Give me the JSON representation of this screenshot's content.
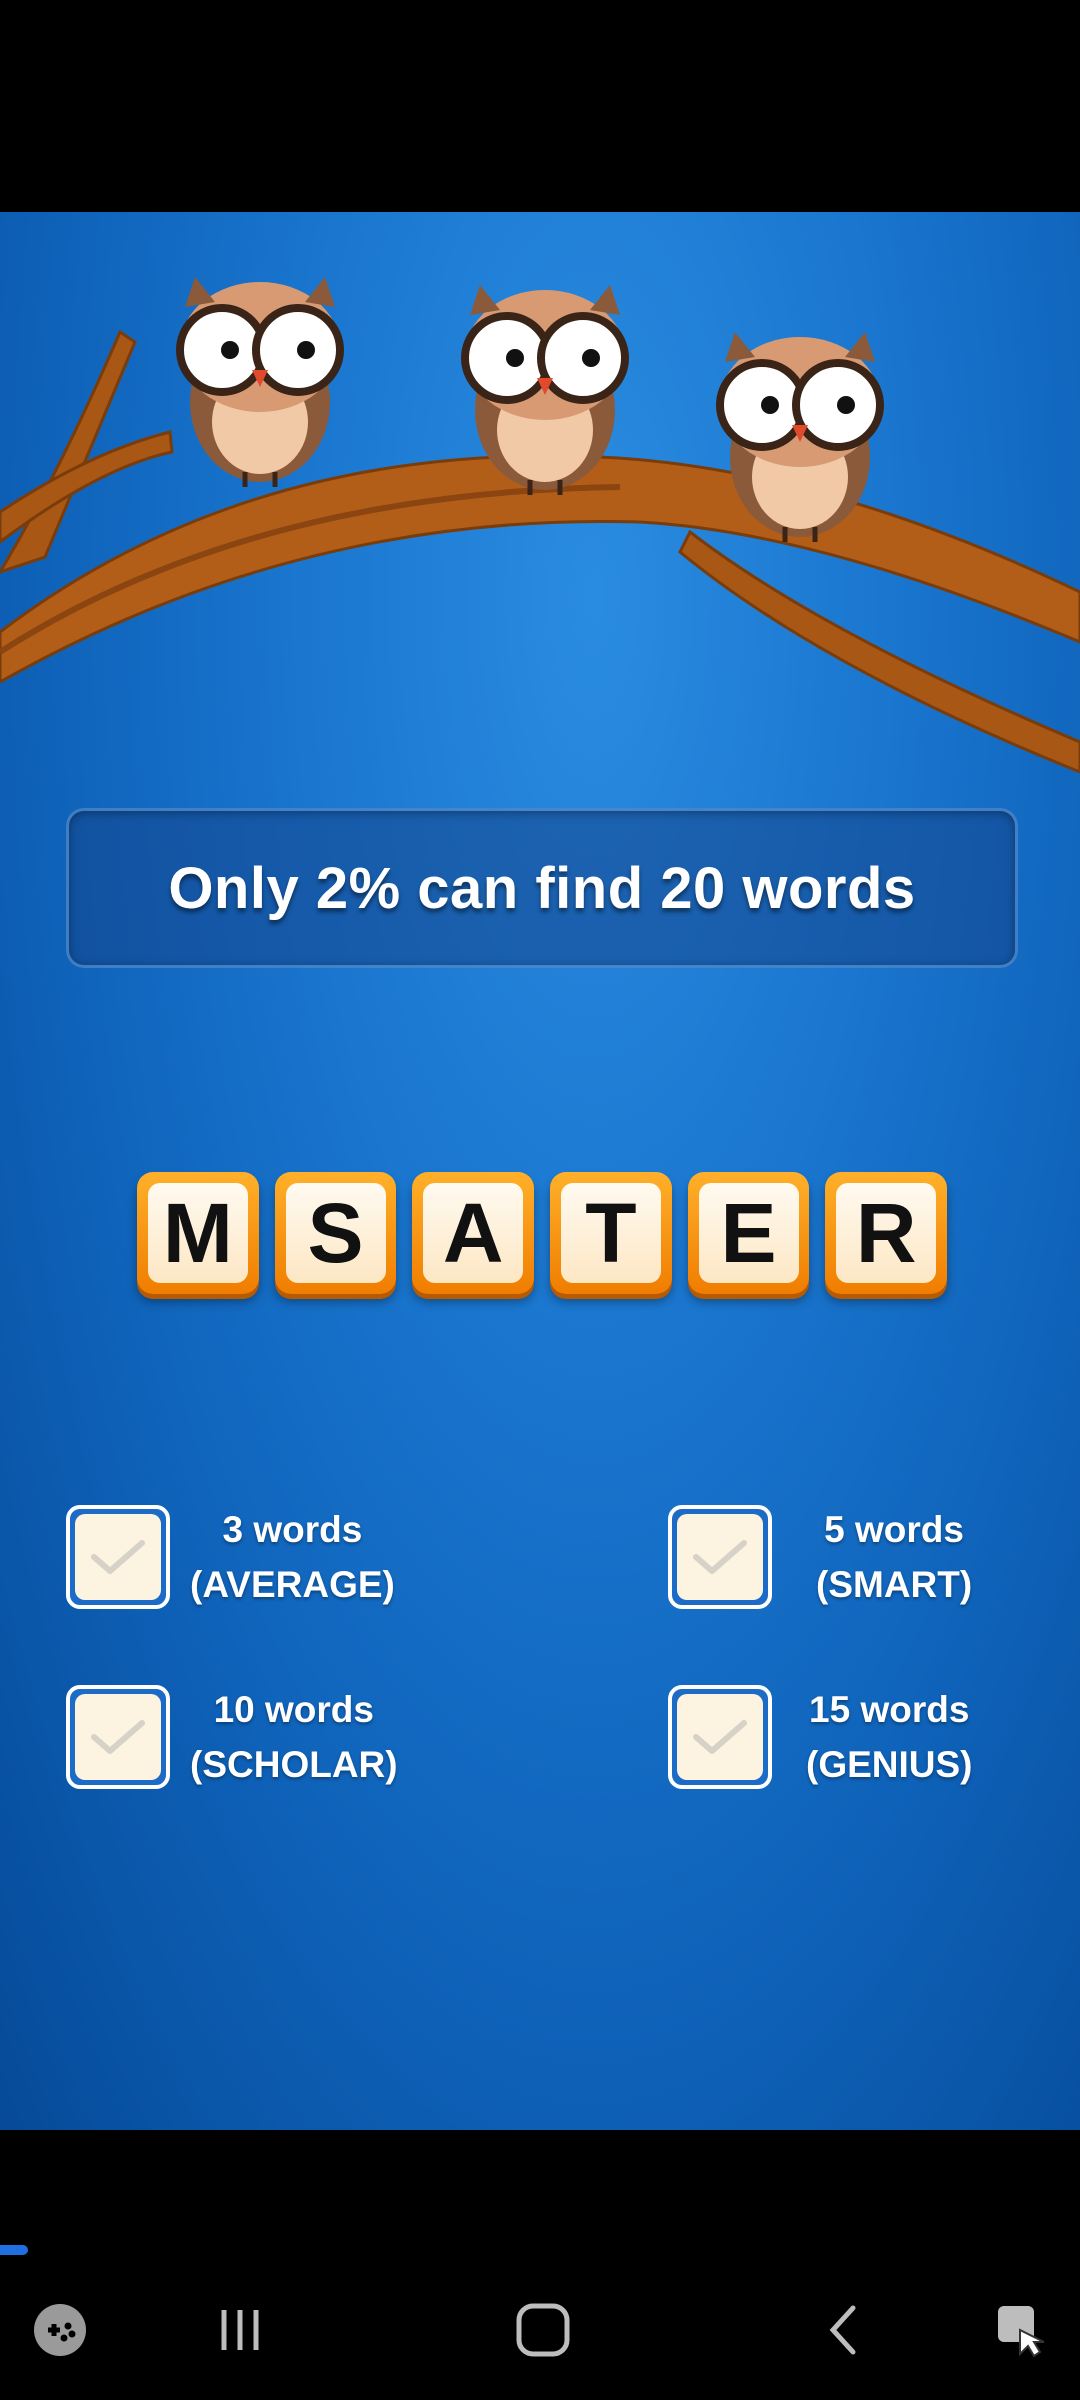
{
  "header": {
    "title": "Only 2% can find 20 words"
  },
  "letters": [
    "M",
    "S",
    "A",
    "T",
    "E",
    "R"
  ],
  "levels": [
    {
      "count": "3 words",
      "rank": "(AVERAGE)"
    },
    {
      "count": "5 words",
      "rank": "(SMART)"
    },
    {
      "count": "10 words",
      "rank": "(SCHOLAR)"
    },
    {
      "count": "15 words",
      "rank": "(GENIUS)"
    }
  ],
  "video_progress": 0.02,
  "colors": {
    "background": "#1a76cf",
    "tile": "#f59a13",
    "checkbox_fill": "#fdf3e1"
  },
  "nav_icons": [
    "game-tools-icon",
    "recent-apps-icon",
    "home-icon",
    "back-icon",
    "screen-assist-icon"
  ]
}
